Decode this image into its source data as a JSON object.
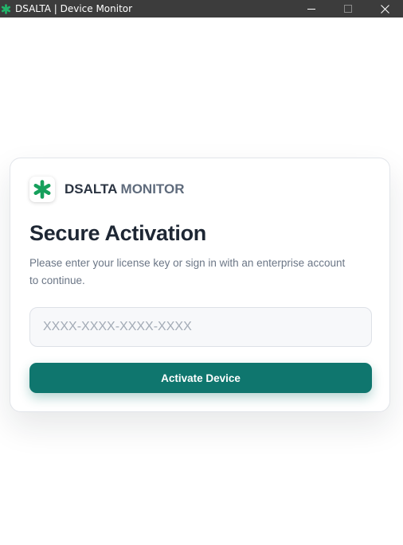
{
  "window": {
    "title": "DSALTA | Device Monitor",
    "app_icon": "asterisk-icon",
    "controls": [
      "minimize-icon",
      "maximize-icon",
      "close-icon"
    ]
  },
  "brand": {
    "logo_icon": "asterisk-logo-icon",
    "name": "DSALTA",
    "suffix": "MONITOR"
  },
  "activation": {
    "heading": "Secure Activation",
    "description": "Please enter your license key or sign in with an enterprise account to continue.",
    "license_input": {
      "value": "",
      "placeholder": "XXXX-XXXX-XXXX-XXXX"
    },
    "button_label": "Activate Device"
  },
  "colors": {
    "accent": "#0f766e",
    "logo_green": "#16a05c",
    "titlebar": "#3c3c3c"
  }
}
